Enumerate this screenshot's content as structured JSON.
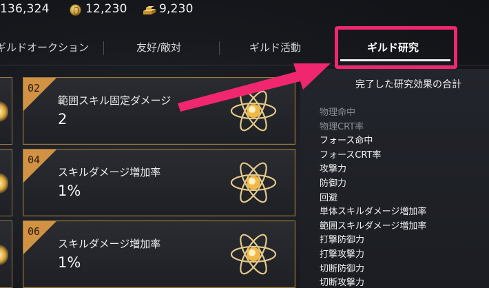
{
  "currency": {
    "first": "136,324",
    "coins": "12,230",
    "gold": "9,230",
    "coin_icon": "coin-icon",
    "gold_icon": "gold-bars-icon"
  },
  "tabs": [
    {
      "label": "ギルドオークション",
      "active": false
    },
    {
      "label": "友好/敵対",
      "active": false
    },
    {
      "label": "ギルド活動",
      "active": false
    },
    {
      "label": "ギルド研究",
      "active": true
    }
  ],
  "cards": [
    {
      "num": "02",
      "title": "範囲スキル固定ダメージ",
      "value": "2",
      "icon": "atom-icon"
    },
    {
      "num": "04",
      "title": "スキルダメージ増加率",
      "value": "1%",
      "icon": "atom-icon"
    },
    {
      "num": "06",
      "title": "スキルダメージ増加率",
      "value": "1%",
      "icon": "atom-icon"
    }
  ],
  "panel": {
    "title": "完了した研究効果の合計",
    "stats": [
      {
        "label": "物理命中",
        "dim": true
      },
      {
        "label": "物理CRT率",
        "dim": true
      },
      {
        "label": "フォース命中",
        "dim": false
      },
      {
        "label": "フォースCRT率",
        "dim": false
      },
      {
        "label": "攻撃力",
        "dim": false
      },
      {
        "label": "防御力",
        "dim": false
      },
      {
        "label": "回避",
        "dim": false
      },
      {
        "label": "単体スキルダメージ増加率",
        "dim": false
      },
      {
        "label": "範囲スキルダメージ増加率",
        "dim": false
      },
      {
        "label": "打撃防御力",
        "dim": false
      },
      {
        "label": "打撃攻撃力",
        "dim": false
      },
      {
        "label": "切断防御力",
        "dim": false
      },
      {
        "label": "切断攻撃力",
        "dim": false
      }
    ]
  },
  "colors": {
    "highlight": "#f0276f",
    "card_accent": "#d19243",
    "card_border": "#9a7a44",
    "background": "#15171c"
  }
}
